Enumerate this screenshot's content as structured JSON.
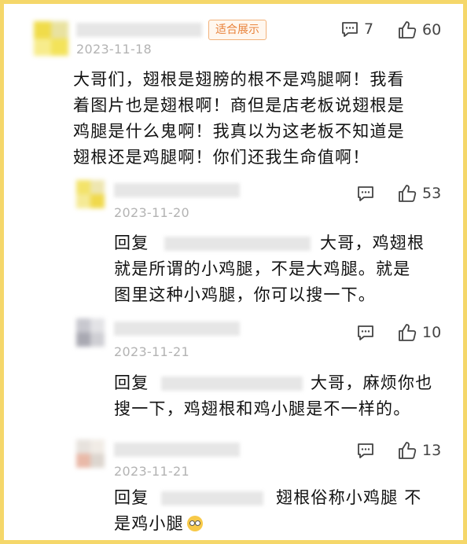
{
  "top_comment": {
    "date": "2023-11-18",
    "badge": "适合展示",
    "reply_count": "7",
    "like_count": "60",
    "lines": [
      "大哥们，翅根是翅膀的根不是鸡腿啊！我看",
      "着图片也是翅根啊！商但是店老板说翅根是",
      "鸡腿是什么鬼啊！我真以为这老板不知道是",
      "翅根还是鸡腿啊！你们还我生命值啊！"
    ]
  },
  "replies": [
    {
      "date": "2023-11-20",
      "like_count": "53",
      "prefix": "回复",
      "line1_suffix": "大哥，鸡翅根",
      "lines": [
        "就是所谓的小鸡腿，不是大鸡腿。就是",
        "图里这种小鸡腿，你可以搜一下。"
      ]
    },
    {
      "date": "2023-11-21",
      "like_count": "10",
      "prefix": "回复",
      "line1_suffix": "大哥，麻烦你也",
      "lines": [
        "搜一下，鸡翅根和鸡小腿是不一样的。"
      ]
    },
    {
      "date": "2023-11-21",
      "like_count": "13",
      "prefix": "回复",
      "line1_suffix": "翅根俗称小鸡腿 不",
      "lines": [
        "是鸡小腿"
      ],
      "emoji": "rolling-eyes-emoji"
    }
  ],
  "colors": {
    "border": "#f5d76a",
    "badge_text": "#e8823a",
    "date": "#b3b3b3"
  }
}
